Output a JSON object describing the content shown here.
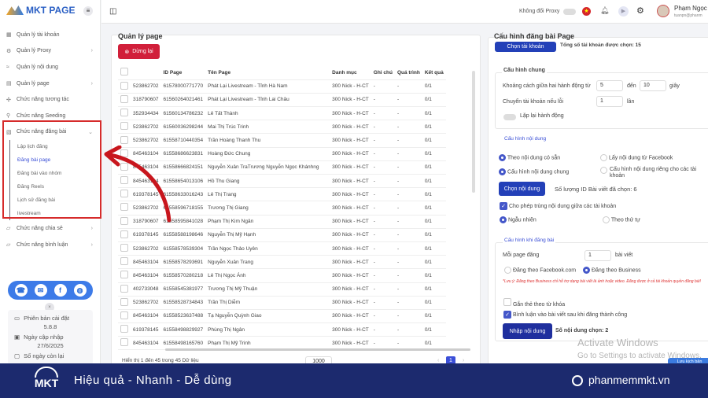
{
  "brand": {
    "name": "MKT PAGE"
  },
  "sidebar": {
    "items": [
      {
        "label": "Quản lý tài khoản",
        "icon": "grid",
        "chev": ""
      },
      {
        "label": "Quản lý Proxy",
        "icon": "gear",
        "chev": "›"
      },
      {
        "label": "Quản lý nội dung",
        "icon": "content",
        "chev": ""
      },
      {
        "label": "Quản lý page",
        "icon": "page",
        "chev": "›"
      },
      {
        "label": "Chức năng tương tác",
        "icon": "interact",
        "chev": ""
      },
      {
        "label": "Chức năng Seeding",
        "icon": "seed",
        "chev": ""
      },
      {
        "label": "Chức năng đăng bài",
        "icon": "post",
        "chev": "⌄"
      }
    ],
    "sub": [
      "Lập lịch đăng",
      "Đăng bài page",
      "Đăng bài vào nhóm",
      "Đăng Reels",
      "Lịch sử đăng bài",
      "livestream"
    ],
    "after": [
      {
        "label": "Chức năng chia sẻ",
        "chev": "›"
      },
      {
        "label": "Chức năng bình luận",
        "chev": "›"
      }
    ],
    "info": {
      "version_label": "Phiên bản cài đặt",
      "version": "5.8.8",
      "update_label": "Ngày cập nhập",
      "update": "27/6/2025",
      "days_label": "Số ngày còn lại"
    }
  },
  "topbar": {
    "proxy_label": "Không đổi Proxy",
    "user_name": "Phạm Ngọc",
    "user_email": "tuanpn@phanm"
  },
  "left": {
    "title": "Quản lý page",
    "stop_label": "Dừng lại",
    "columns": [
      "",
      "ID Page",
      "Tên Page",
      "Danh mục",
      "Ghi chú",
      "Quá trình",
      "Kết quả"
    ],
    "rows": [
      [
        "523862702",
        "61578000771770",
        "Phát Lại Livestream - Tỉnh Hà Nam",
        "300 Nick - H-CT",
        "-",
        "-",
        "0/1"
      ],
      [
        "318790607",
        "61560264021461",
        "Phát Lại Livestream - Tỉnh Lai Châu",
        "300 Nick - H-CT",
        "-",
        "-",
        "0/1"
      ],
      [
        "352934434",
        "61560134786232",
        "Lê Tất Thành",
        "300 Nick - H-CT",
        "-",
        "-",
        "0/1"
      ],
      [
        "523862702",
        "61560036298244",
        "Mai Thị Trúc Trinh",
        "300 Nick - H-CT",
        "-",
        "-",
        "0/1"
      ],
      [
        "523862702",
        "61558710440354",
        "Trần Hoàng Thanh Thu",
        "300 Nick - H-CT",
        "-",
        "-",
        "0/1"
      ],
      [
        "845463104",
        "61558686623831",
        "Hoàng Đức Chung",
        "300 Nick - H-CT",
        "-",
        "-",
        "0/1"
      ],
      [
        "845463104",
        "61558666824151",
        "Nguyễn Xuân TraTrương Nguyễn Ngọc Khánhng",
        "300 Nick - H-CT",
        "-",
        "-",
        "0/1"
      ],
      [
        "845463104",
        "61558654013106",
        "Hồ Thu Giang",
        "300 Nick - H-CT",
        "-",
        "-",
        "0/1"
      ],
      [
        "619378145",
        "61558633016243",
        "Lê Thị Trang",
        "300 Nick - H-CT",
        "-",
        "-",
        "0/1"
      ],
      [
        "523862702",
        "61558596718155",
        "Trương Thị Giang",
        "300 Nick - H-CT",
        "-",
        "-",
        "0/1"
      ],
      [
        "318790607",
        "61558595841028",
        "Phạm Thị Kim Ngân",
        "300 Nick - H-CT",
        "-",
        "-",
        "0/1"
      ],
      [
        "619378145",
        "61558588198646",
        "Nguyễn Thị Mỹ Hạnh",
        "300 Nick - H-CT",
        "-",
        "-",
        "0/1"
      ],
      [
        "523862702",
        "61558578539304",
        "Trần Ngọc Thảo Uyên",
        "300 Nick - H-CT",
        "-",
        "-",
        "0/1"
      ],
      [
        "845463104",
        "61558578293691",
        "Nguyễn Xuân Trang",
        "300 Nick - H-CT",
        "-",
        "-",
        "0/1"
      ],
      [
        "845463104",
        "61558570280218",
        "Lê Thị Ngọc Ánh",
        "300 Nick - H-CT",
        "-",
        "-",
        "0/1"
      ],
      [
        "402733048",
        "61558545381977",
        "Trương Thị Mỹ Thuận",
        "300 Nick - H-CT",
        "-",
        "-",
        "0/1"
      ],
      [
        "523862702",
        "61558528734843",
        "Trần Thị Diễm",
        "300 Nick - H-CT",
        "-",
        "-",
        "0/1"
      ],
      [
        "845463104",
        "61558523637488",
        "Tạ Nguyễn Quỳnh Giao",
        "300 Nick - H-CT",
        "-",
        "-",
        "0/1"
      ],
      [
        "619378145",
        "61558498829927",
        "Phùng Thị Ngân",
        "300 Nick - H-CT",
        "-",
        "-",
        "0/1"
      ],
      [
        "845463104",
        "61558498165760",
        "Phạm Thị Mỹ Trinh",
        "300 Nick - H-CT",
        "-",
        "-",
        "0/1"
      ]
    ],
    "footer": "Hiển thị 1 đến 45 trong 45 Dữ liệu",
    "page_size": "1000",
    "page": "1",
    "prev": "‹",
    "next": "›"
  },
  "right": {
    "title": "Cấu hình đăng bài Page",
    "choose_account": "Chọn tài khoản",
    "total_accounts": "Tổng số tài khoản được chọn: 15",
    "general": {
      "title": "Cấu hình chung",
      "delay_label": "Khoảng cách giữa hai hành động từ",
      "delay_from": "5",
      "to": "đến",
      "delay_to": "10",
      "seconds": "giây",
      "switch_label": "Chuyển tài khoản nếu lỗi",
      "switch_val": "1",
      "times": "lần",
      "repeat": "Lặp lại hành động"
    },
    "content": {
      "title": "Cấu hình nội dung",
      "opt1": "Theo nội dung có sẵn",
      "opt2": "Lấy nội dung từ Facebook",
      "opt3": "Cấu hình nội dung chung",
      "opt4": "Cấu hình nội dung riêng cho các tài khoản",
      "choose_btn": "Chọn nội dung",
      "count": "Số lượng ID Bài viết đã chọn: 6",
      "allow_dup": "Cho phép trùng nội dung giữa các tài khoản",
      "random": "Ngẫu nhiên",
      "ordered": "Theo thứ tự"
    },
    "post": {
      "title": "Cấu hình khi đăng bài",
      "per_page_label": "Mỗi page đăng",
      "per_page": "1",
      "posts": "bài viết",
      "via_fb": "Đăng theo Facebook.com",
      "via_biz": "Đăng theo Business",
      "note": "*Lưu ý: Đăng theo Business chỉ hỗ trợ dạng bài viết là ảnh hoặc video. Đăng được ở cả tài khoản quyền đăng bài!",
      "tag_kw": "Gắn thẻ theo từ khóa",
      "comment": "Bình luận vào bài viết sau khi đăng thành công",
      "import_btn": "Nhập nội dung",
      "import_count": "Số nội dung chọn: 2"
    },
    "save": "Lưu kịch bản"
  },
  "watermark": {
    "l1": "Activate Windows",
    "l2": "Go to Settings to activate Windows."
  },
  "banner": {
    "logo": "MKT",
    "slogan": "Hiệu quả - Nhanh - Dễ dùng",
    "site": "phanmemmkt.vn"
  }
}
